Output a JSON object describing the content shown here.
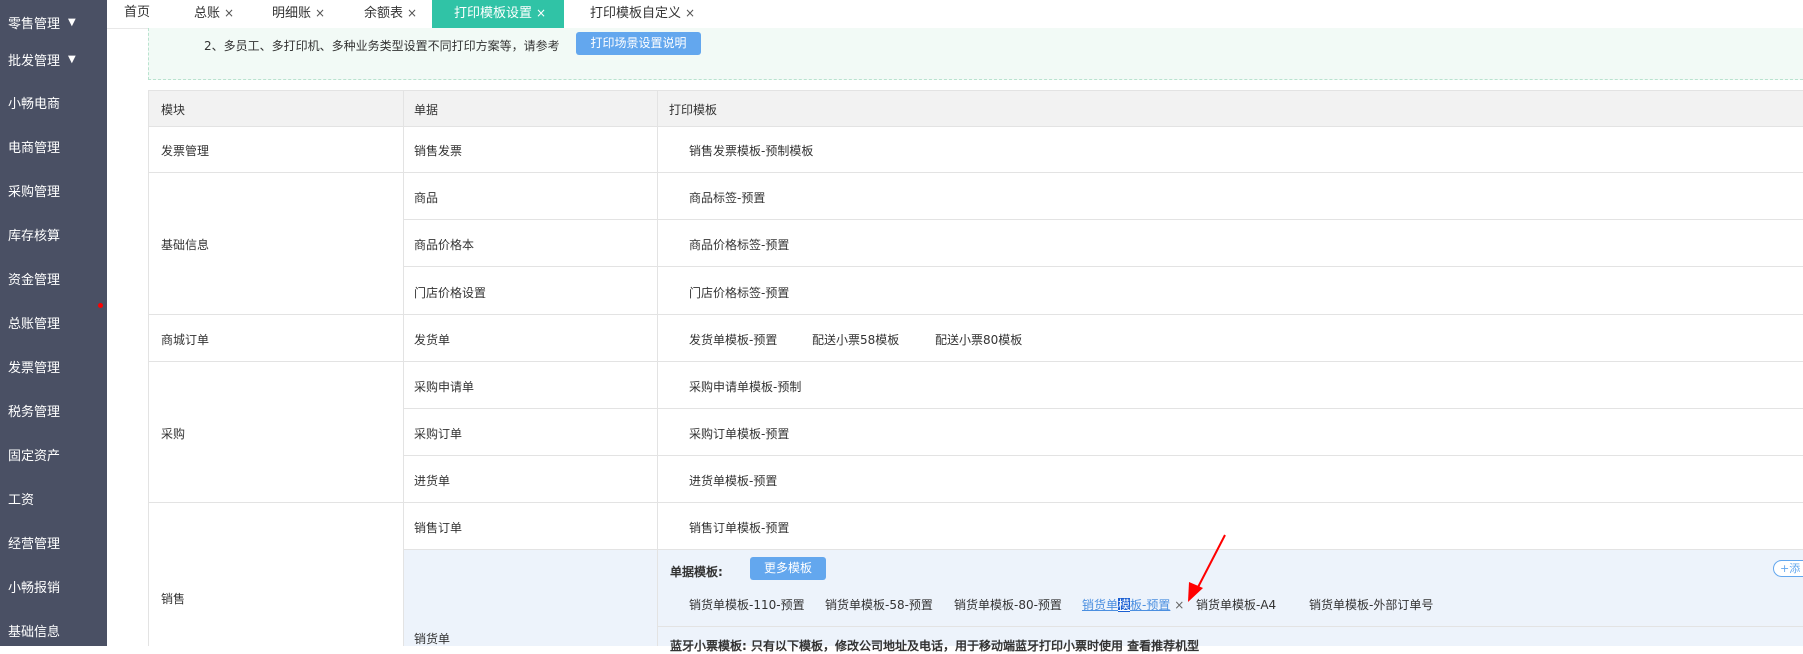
{
  "sidebar": {
    "items": [
      {
        "label": "零售管理",
        "caret": "▼"
      },
      {
        "label": "批发管理",
        "caret": "▼"
      },
      {
        "label": "小畅电商"
      },
      {
        "label": "电商管理"
      },
      {
        "label": "采购管理"
      },
      {
        "label": "库存核算"
      },
      {
        "label": "资金管理"
      },
      {
        "label": "总账管理"
      },
      {
        "label": "发票管理"
      },
      {
        "label": "税务管理"
      },
      {
        "label": "固定资产"
      },
      {
        "label": "工资"
      },
      {
        "label": "经营管理"
      },
      {
        "label": "小畅报销"
      },
      {
        "label": "基础信息"
      }
    ]
  },
  "tabs": [
    {
      "label": "首页"
    },
    {
      "label": "总账",
      "close": "×"
    },
    {
      "label": "明细账",
      "close": "×"
    },
    {
      "label": "余额表",
      "close": "×"
    },
    {
      "label": "打印模板设置",
      "close": "×",
      "active": true
    },
    {
      "label": "打印模板自定义",
      "close": "×"
    }
  ],
  "notice": {
    "text": "2、多员工、多打印机、多种业务类型设置不同打印方案等，请参考",
    "button": "打印场景设置说明"
  },
  "table": {
    "headers": {
      "module": "模块",
      "document": "单据",
      "template": "打印模板"
    },
    "modules": {
      "invoice": "发票管理",
      "basic": "基础信息",
      "mall": "商城订单",
      "purchase": "采购",
      "sales": "销售"
    },
    "documents": {
      "sales_invoice": "销售发票",
      "goods": "商品",
      "price_book": "商品价格本",
      "store_price": "门店价格设置",
      "delivery": "发货单",
      "purchase_request": "采购申请单",
      "purchase_order": "采购订单",
      "inbound": "进货单",
      "sales_order": "销售订单",
      "sales_slip": "销货单"
    },
    "templates": {
      "sales_invoice": "销售发票模板-预制模板",
      "goods": "商品标签-预置",
      "price_book": "商品价格标签-预置",
      "store_price": "门店价格标签-预置",
      "delivery_1": "发货单模板-预置",
      "delivery_2": "配送小票58模板",
      "delivery_3": "配送小票80模板",
      "purchase_request": "采购申请单模板-预制",
      "purchase_order": "采购订单模板-预置",
      "inbound": "进货单模板-预置",
      "sales_order": "销售订单模板-预置"
    },
    "sales_slip_panel": {
      "label": "单据模板:",
      "more_button": "更多模板",
      "add_button": "+添",
      "templates": [
        "销货单模板-110-预置",
        "销货单模板-58-预置",
        "销货单模板-80-预置"
      ],
      "selected_prefix": "销货单",
      "selected_highlight": "模",
      "selected_suffix": "板-预置",
      "selected_close": "×",
      "templates_after": [
        "销货单模板-A4",
        "销货单模板-外部订单号"
      ],
      "bottom_text": "蓝牙小票模板:  只有以下模板，修改公司地址及电话，用于移动端蓝牙打印小票时使用  查看推荐机型"
    }
  }
}
